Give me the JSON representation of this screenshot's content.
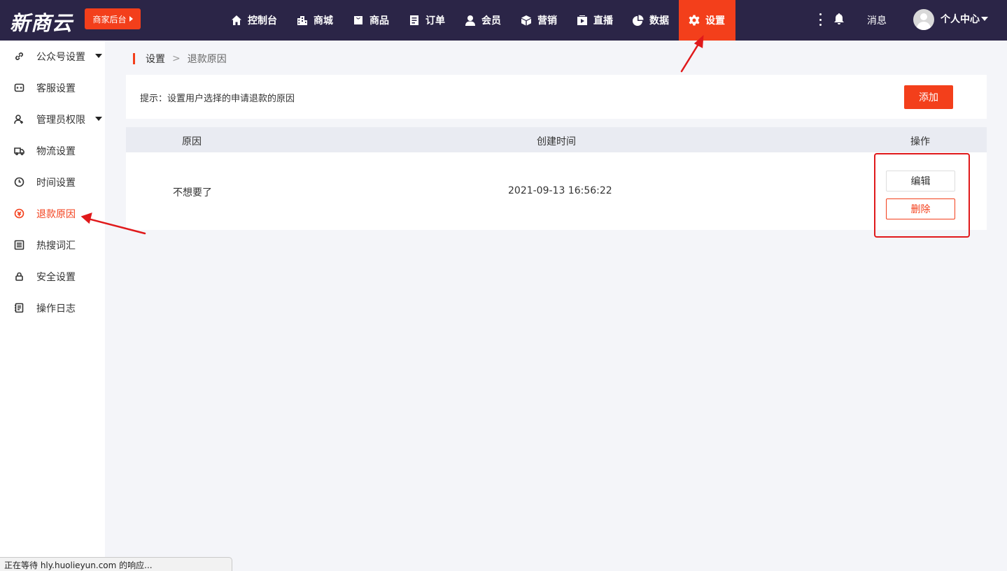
{
  "app": {
    "logo_text": "新商云",
    "merchant_button_label": "商家后台"
  },
  "nav": {
    "items": [
      {
        "label": "控制台",
        "icon": "home-icon"
      },
      {
        "label": "商城",
        "icon": "building-icon"
      },
      {
        "label": "商品",
        "icon": "bag-icon"
      },
      {
        "label": "订单",
        "icon": "list-icon"
      },
      {
        "label": "会员",
        "icon": "user-icon"
      },
      {
        "label": "营销",
        "icon": "cube-icon"
      },
      {
        "label": "直播",
        "icon": "play-icon"
      },
      {
        "label": "数据",
        "icon": "pie-icon"
      },
      {
        "label": "设置",
        "icon": "gear-icon",
        "active": true
      }
    ],
    "messages_label": "消息",
    "user_center_label": "个人中心"
  },
  "sidebar": {
    "items": [
      {
        "label": "公众号设置",
        "icon": "link-icon",
        "has_caret": true
      },
      {
        "label": "客服设置",
        "icon": "chat-icon"
      },
      {
        "label": "管理员权限",
        "icon": "admin-icon",
        "has_caret": true
      },
      {
        "label": "物流设置",
        "icon": "truck-icon"
      },
      {
        "label": "时间设置",
        "icon": "clock-icon"
      },
      {
        "label": "退款原因",
        "icon": "refund-icon",
        "active": true
      },
      {
        "label": "热搜词汇",
        "icon": "list-box-icon"
      },
      {
        "label": "安全设置",
        "icon": "lock-icon"
      },
      {
        "label": "操作日志",
        "icon": "log-icon"
      }
    ]
  },
  "breadcrumb": {
    "parent": "设置",
    "separator": ">",
    "current": "退款原因"
  },
  "tip": {
    "text": "提示：设置用户选择的申请退款的原因",
    "add_button_label": "添加"
  },
  "table": {
    "headers": [
      "原因",
      "创建时间",
      "操作"
    ],
    "rows": [
      {
        "reason": "不想要了",
        "created_at": "2021-09-13 16:56:22",
        "edit_label": "编辑",
        "delete_label": "删除"
      }
    ]
  },
  "status_bar": {
    "text": "正在等待 hly.huolieyun.com 的响应..."
  },
  "colors": {
    "topbar_bg": "#2b2547",
    "accent": "#f33f1b",
    "annotation_red": "#e0191b"
  }
}
